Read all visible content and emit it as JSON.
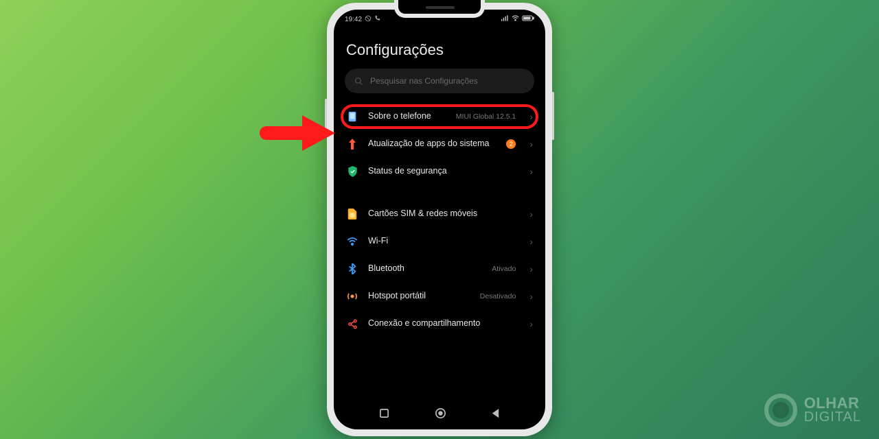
{
  "statusbar": {
    "time": "19:42"
  },
  "page_title": "Configurações",
  "search_placeholder": "Pesquisar nas Configurações",
  "group1": [
    {
      "icon": "phone-about",
      "label": "Sobre o telefone",
      "meta": "MIUI Global 12.5.1",
      "highlighted": true
    },
    {
      "icon": "update-arrow",
      "label": "Atualização de apps do sistema",
      "badge": "2"
    },
    {
      "icon": "shield-check",
      "label": "Status de segurança"
    }
  ],
  "group2": [
    {
      "icon": "sim",
      "label": "Cartões SIM & redes móveis"
    },
    {
      "icon": "wifi",
      "label": "Wi-Fi"
    },
    {
      "icon": "bluetooth",
      "label": "Bluetooth",
      "meta": "Ativado"
    },
    {
      "icon": "hotspot",
      "label": "Hotspot portátil",
      "meta": "Desativado"
    },
    {
      "icon": "share",
      "label": "Conexão e compartilhamento"
    }
  ],
  "watermark": {
    "line1": "OLHAR",
    "line2": "DIGITAL"
  }
}
